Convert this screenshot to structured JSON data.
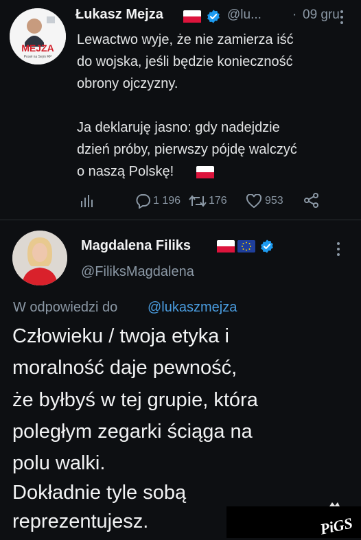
{
  "tweet1": {
    "author_name": "Łukasz Mejza",
    "handle": "@lu...",
    "separator": "·",
    "date": "09 gru",
    "avatar_text": "MEJZA",
    "avatar_subtext": "Poseł na Sejm RP",
    "text_lines": [
      "Lewactwo wyje, że nie zamierza iść",
      "do wojska, jeśli będzie konieczność",
      "obrony ojczyzny.",
      "",
      "Ja deklaruję jasno: gdy nadejdzie",
      "dzień próby, pierwszy pójdę walczyć",
      "o naszą Polskę!"
    ],
    "replies": "1 196",
    "retweets": "176",
    "likes": "953"
  },
  "tweet2": {
    "author_name": "Magdalena Filiks",
    "handle": "@FiliksMagdalena",
    "reply_prefix": "W odpowiedzi do",
    "reply_mention": "@lukaszmejza",
    "text_lines": [
      "Człowieku / twoja etyka i",
      "moralność daje pewność,",
      "że byłbyś w tej grupie, która",
      "poległym zegarki ściąga na",
      "polu walki.",
      "Dokładnie tyle sobą",
      "reprezentujesz."
    ]
  },
  "watermark": "PiGS",
  "colors": {
    "background": "#0d0f12",
    "text": "#e7e9ea",
    "secondary": "#8b98a5",
    "link": "#4a9de0",
    "verified": "#1d9bf0",
    "like": "#8b98a5"
  },
  "icons": [
    "polish-flag-icon",
    "verified-badge-icon",
    "more-options-icon",
    "analytics-icon",
    "reply-icon",
    "retweet-icon",
    "like-icon",
    "share-icon",
    "eu-flag-icon"
  ]
}
